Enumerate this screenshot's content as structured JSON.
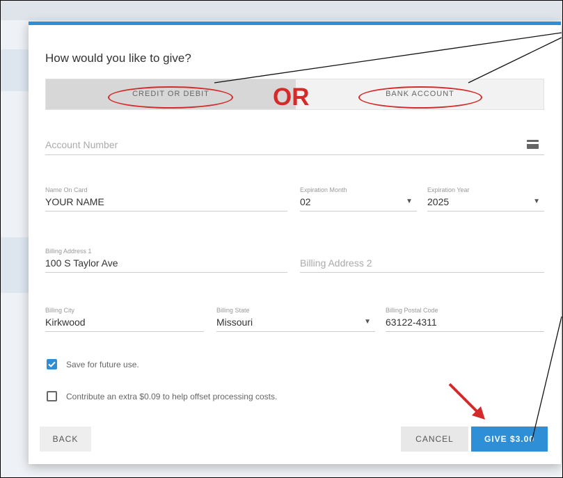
{
  "dialog": {
    "title": "How would you like to give?"
  },
  "payment_type": {
    "options": [
      {
        "label": "CREDIT OR DEBIT",
        "selected": true
      },
      {
        "label": "BANK ACCOUNT",
        "selected": false
      }
    ],
    "annotation_text": "OR"
  },
  "form": {
    "account_number": {
      "placeholder": "Account Number",
      "value": ""
    },
    "name_on_card": {
      "label": "Name On Card",
      "value": "YOUR NAME"
    },
    "expiration_month": {
      "label": "Expiration Month",
      "value": "02"
    },
    "expiration_year": {
      "label": "Expiration Year",
      "value": "2025"
    },
    "billing_address_1": {
      "label": "Billing Address 1",
      "value": "100 S Taylor Ave"
    },
    "billing_address_2": {
      "placeholder": "Billing Address 2",
      "value": ""
    },
    "billing_city": {
      "label": "Billing City",
      "value": "Kirkwood"
    },
    "billing_state": {
      "label": "Billing State",
      "value": "Missouri"
    },
    "billing_postal_code": {
      "label": "Billing Postal Code",
      "value": "63122-4311"
    }
  },
  "options": {
    "save_for_future": {
      "label": "Save for future use.",
      "checked": true
    },
    "contribute_extra": {
      "label": "Contribute an extra $0.09 to help offset processing costs.",
      "checked": false
    }
  },
  "buttons": {
    "back": "BACK",
    "cancel": "CANCEL",
    "give": "GIVE $3.00"
  },
  "colors": {
    "accent": "#2f8fd6",
    "annotation": "#d42a2a"
  },
  "icons": {
    "card": "credit-card-icon",
    "dropdown": "chevron-down-icon",
    "check": "checkmark-icon"
  }
}
